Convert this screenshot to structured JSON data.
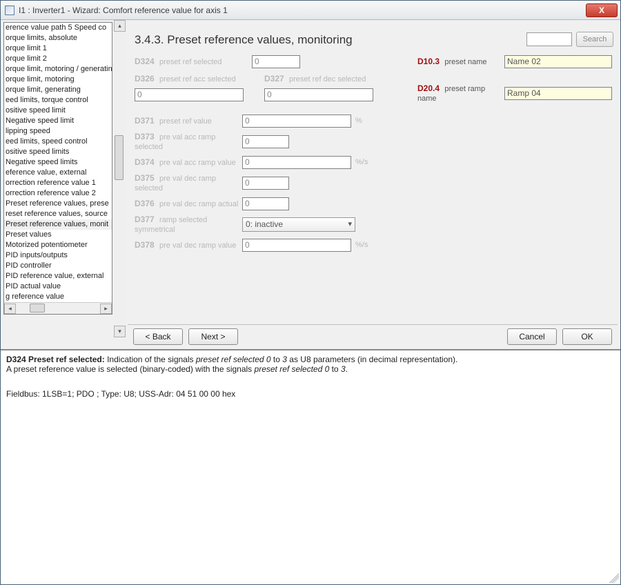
{
  "window": {
    "title": "I1 : Inverter1 - Wizard: Comfort reference value for axis 1",
    "close_glyph": "X"
  },
  "sidebar": {
    "items": [
      "erence value path 5 Speed co",
      "orque limits, absolute",
      "orque limit 1",
      "orque limit 2",
      "orque limit, motoring / generatin",
      "orque limit, motoring",
      "orque limit, generating",
      "eed limits, torque control",
      "ositive speed limit",
      "Negative speed limit",
      "lipping speed",
      "eed limits, speed control",
      "ositive speed limits",
      "Negative speed limits",
      "eference value, external",
      "orrection reference value 1",
      "orrection reference value 2",
      "Preset reference values, prese",
      "reset reference values, source",
      "Preset reference values, monit",
      "Preset values",
      "Motorized potentiometer",
      "PID inputs/outputs",
      "PID controller",
      "PID reference value, external",
      "PID actual value",
      "g reference value"
    ]
  },
  "header": {
    "title": "3.4.3. Preset reference values, monitoring",
    "search_label": "Search"
  },
  "params": {
    "d324": {
      "code": "D324",
      "label": "preset ref selected",
      "value": "0"
    },
    "d326": {
      "code": "D326",
      "label": "preset ref acc selected",
      "value": "0"
    },
    "d327": {
      "code": "D327",
      "label": "preset ref dec selected",
      "value": "0"
    },
    "d371": {
      "code": "D371",
      "label": "preset ref value",
      "value": "0",
      "unit": "%"
    },
    "d373": {
      "code": "D373",
      "label": "pre val acc ramp selected",
      "value": "0"
    },
    "d374": {
      "code": "D374",
      "label": "pre val acc ramp value",
      "value": "0",
      "unit": "%/s"
    },
    "d375": {
      "code": "D375",
      "label": "pre val dec ramp selected",
      "value": "0"
    },
    "d376": {
      "code": "D376",
      "label": "pre val dec ramp actual",
      "value": "0"
    },
    "d377": {
      "code": "D377",
      "label": "ramp selected symmetrical",
      "value": "0: inactive"
    },
    "d378": {
      "code": "D378",
      "label": "pre val dec ramp value",
      "value": "0",
      "unit": "%/s"
    },
    "d10_3": {
      "code": "D10.3",
      "label": "preset name",
      "value": "Name 02"
    },
    "d20_4": {
      "code": "D20.4",
      "label": "preset ramp name",
      "value": "Ramp 04"
    }
  },
  "buttons": {
    "back": "< Back",
    "next": "Next >",
    "cancel": "Cancel",
    "ok": "OK"
  },
  "info": {
    "line1_prefix": "D324  Preset ref selected: ",
    "line1_mid": "Indication of the signals ",
    "line1_em1": "preset ref selected 0 ",
    "line1_mid2": "to ",
    "line1_em2": "3 ",
    "line1_suffix": "as U8 parameters (in decimal representation).",
    "line2_prefix": "A preset reference value is selected (binary-coded) with the signals ",
    "line2_em": "preset ref selected 0 ",
    "line2_mid": "to ",
    "line2_em2": "3",
    "line2_suffix": ".",
    "line3": "Fieldbus: 1LSB=1; PDO ; Type: U8; USS-Adr: 04 51 00 00 hex"
  }
}
